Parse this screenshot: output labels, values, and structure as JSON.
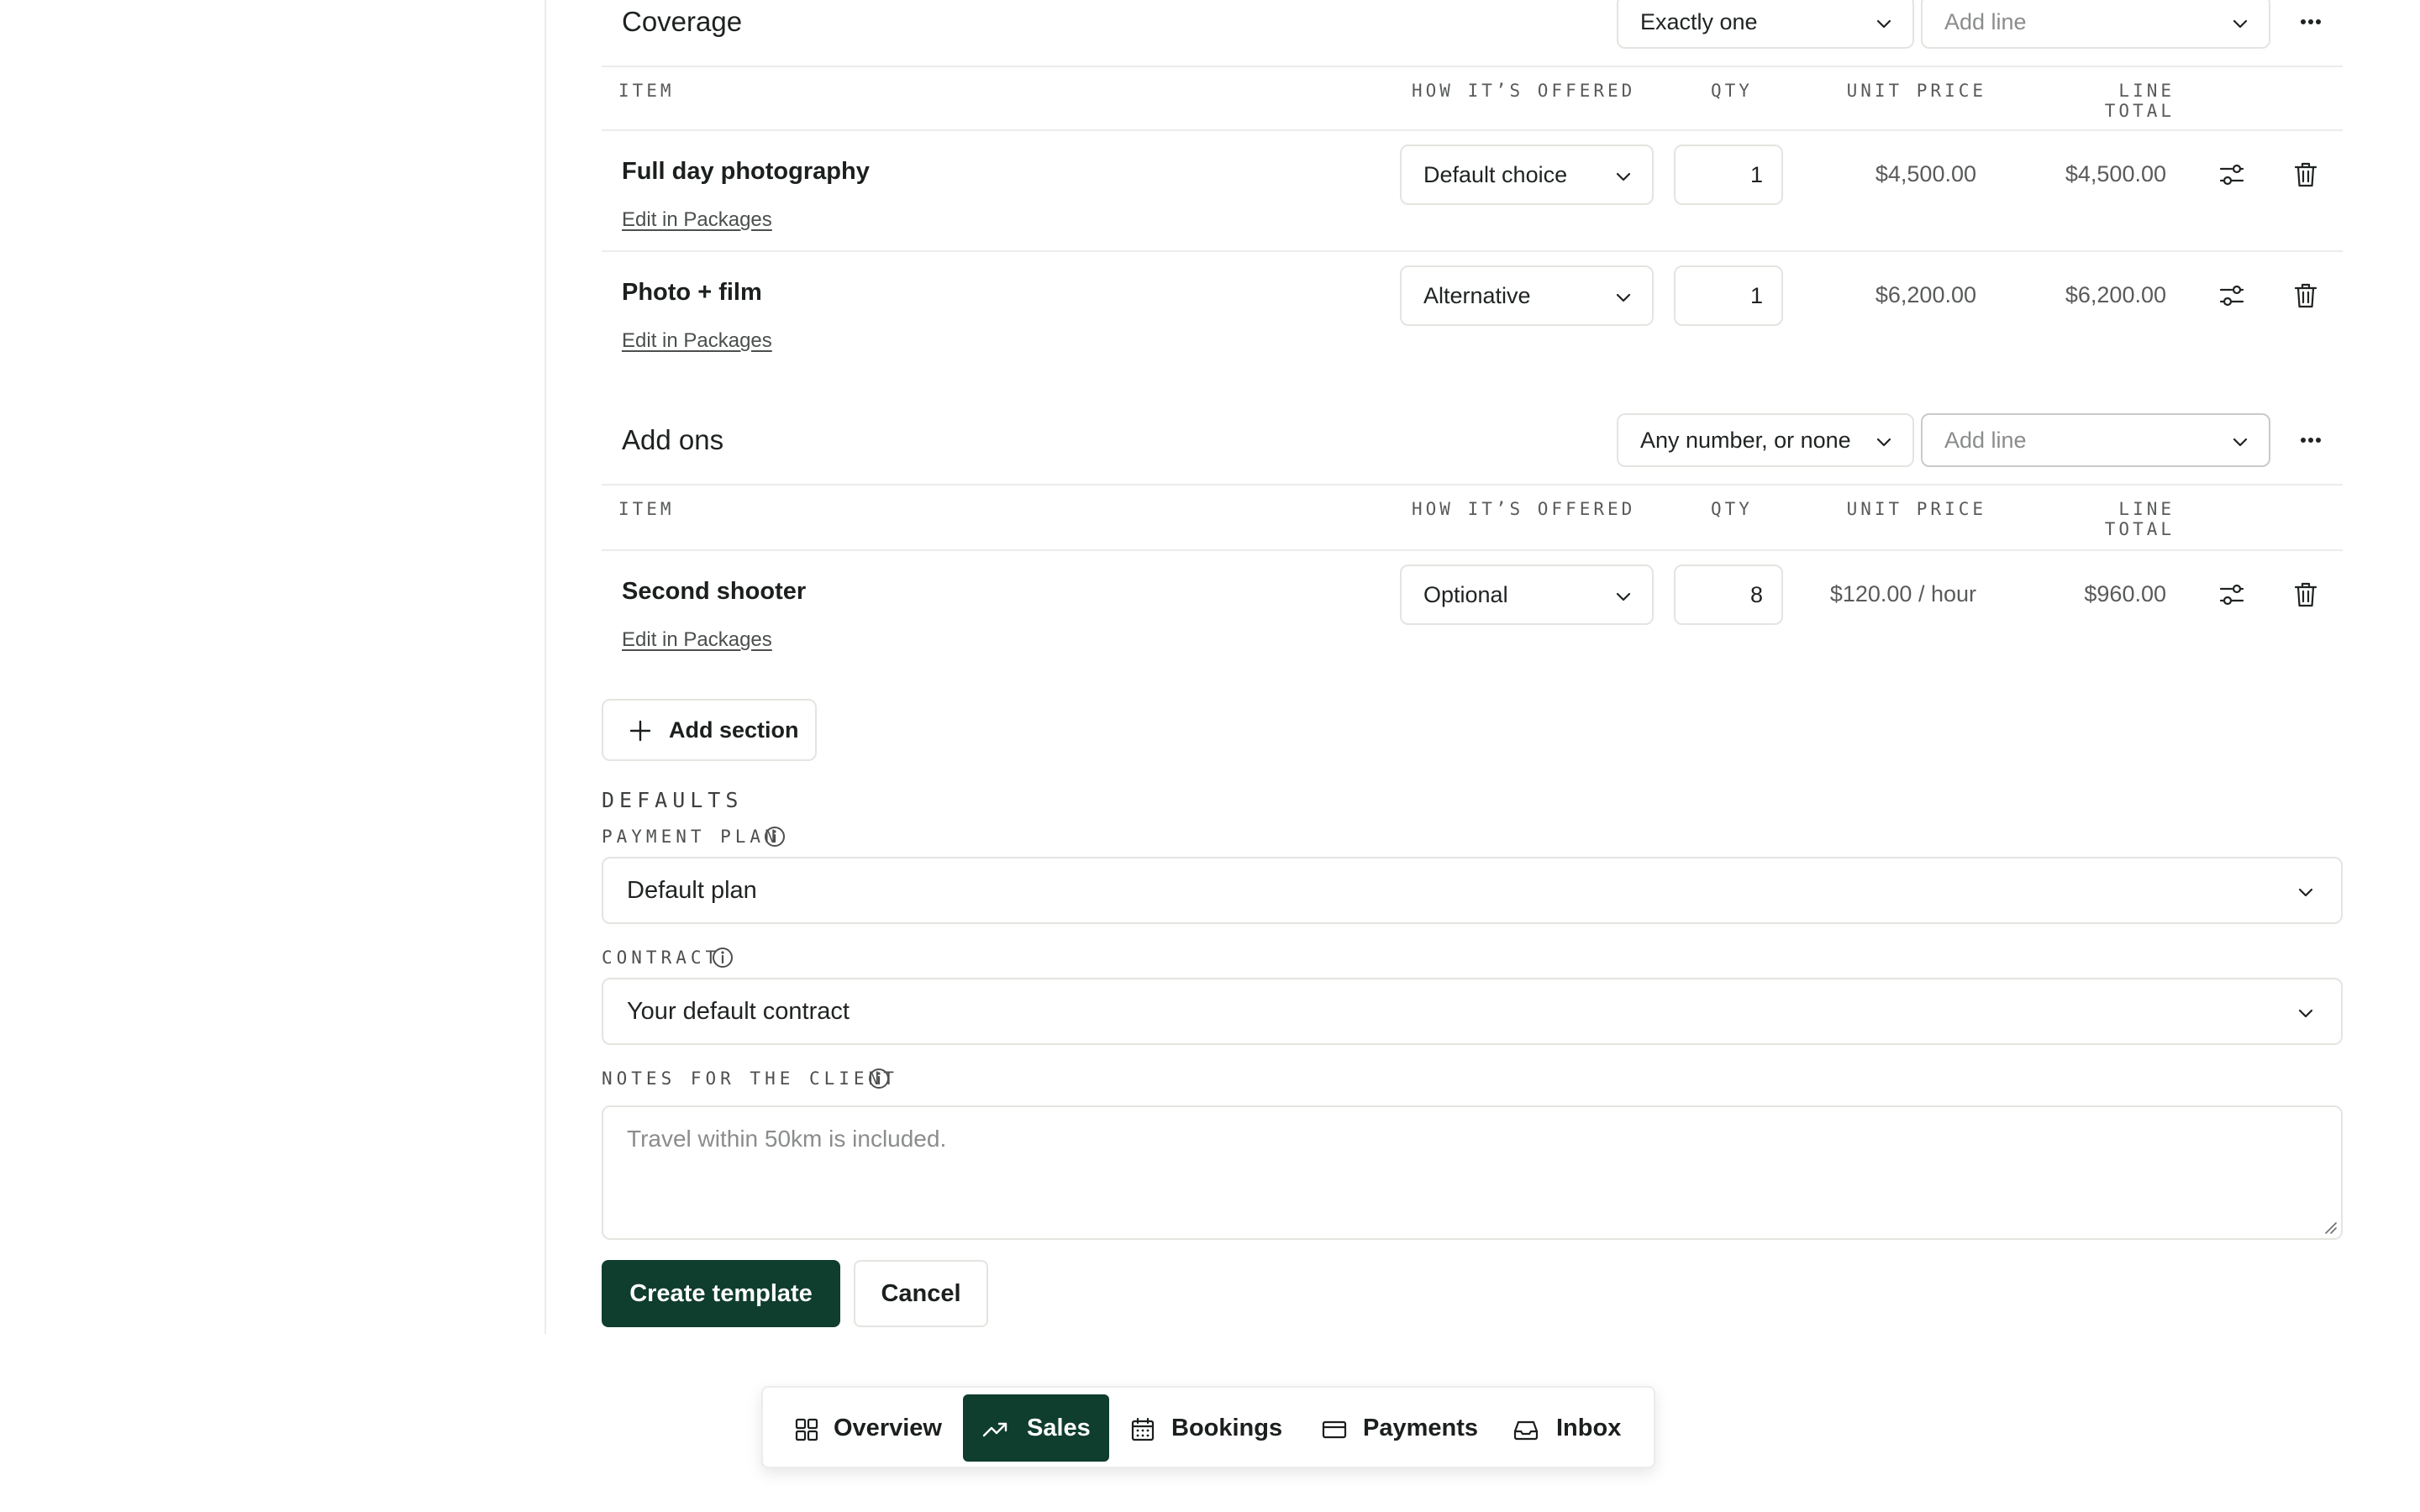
{
  "colors": {
    "accent": "#0f3d2e",
    "border": "#e4e4e0",
    "muted_text": "#585b59"
  },
  "coverage": {
    "title": "Coverage",
    "rule_select": "Exactly one",
    "add_line_placeholder": "Add line",
    "columns": {
      "item": "ITEM",
      "how_offered": "HOW IT’S OFFERED",
      "qty": "QTY",
      "unit_price": "UNIT PRICE",
      "line_total_1": "LINE",
      "line_total_2": "TOTAL"
    },
    "rows": [
      {
        "name": "Full day photography",
        "edit_link": "Edit in Packages",
        "offered": "Default choice",
        "qty": "1",
        "unit_price": "$4,500.00",
        "line_total": "$4,500.00"
      },
      {
        "name": "Photo + film",
        "edit_link": "Edit in Packages",
        "offered": "Alternative",
        "qty": "1",
        "unit_price": "$6,200.00",
        "line_total": "$6,200.00"
      }
    ]
  },
  "addons": {
    "title": "Add ons",
    "rule_select": "Any number, or none",
    "add_line_placeholder": "Add line",
    "columns": {
      "item": "ITEM",
      "how_offered": "HOW IT’S OFFERED",
      "qty": "QTY",
      "unit_price": "UNIT PRICE",
      "line_total_1": "LINE",
      "line_total_2": "TOTAL"
    },
    "rows": [
      {
        "name": "Second shooter",
        "edit_link": "Edit in Packages",
        "offered": "Optional",
        "qty": "8",
        "unit_price": "$120.00 / hour",
        "line_total": "$960.00"
      }
    ]
  },
  "add_section_label": "Add section",
  "defaults": {
    "heading": "DEFAULTS",
    "payment_plan_label": "PAYMENT PLAN",
    "payment_plan_value": "Default plan",
    "contract_label": "CONTRACT",
    "contract_value": "Your default contract",
    "notes_label": "NOTES FOR THE CLIENT",
    "notes_placeholder": "Travel within 50km is included."
  },
  "actions": {
    "create": "Create template",
    "cancel": "Cancel"
  },
  "bottom_nav": {
    "items": [
      {
        "label": "Overview",
        "icon": "grid-icon",
        "active": false
      },
      {
        "label": "Sales",
        "icon": "trending-up-icon",
        "active": true
      },
      {
        "label": "Bookings",
        "icon": "calendar-icon",
        "active": false
      },
      {
        "label": "Payments",
        "icon": "credit-card-icon",
        "active": false
      },
      {
        "label": "Inbox",
        "icon": "inbox-icon",
        "active": false
      }
    ]
  }
}
